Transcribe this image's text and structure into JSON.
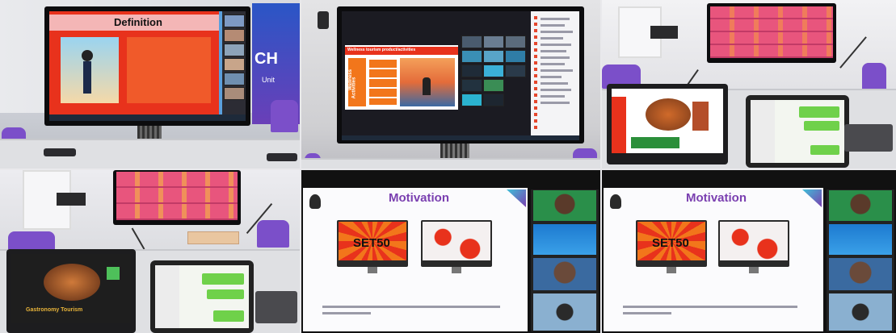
{
  "tiles": {
    "t1": {
      "slide_title": "Definition",
      "side_text_1": "CH",
      "side_text_2": "Unit"
    },
    "t2": {
      "banner_text": "Wellness tourism product/activities",
      "side_label_1": "Wellness",
      "side_label_2": "Activities"
    },
    "t5": {
      "slide_title": "Motivation",
      "poster_text": "SET50"
    },
    "t6": {
      "slide_title": "Motivation",
      "poster_text": "SET50"
    },
    "t4": {
      "laptop_text": "Gastronomy Tourism"
    }
  },
  "colors": {
    "slide_red": "#e8321c",
    "slide_orange": "#f2761b",
    "chair_purple": "#7b4fc9",
    "motivation_purple": "#7a3fb0",
    "chat_green": "#6fd14a",
    "gallery_pink": "#e8557d"
  }
}
